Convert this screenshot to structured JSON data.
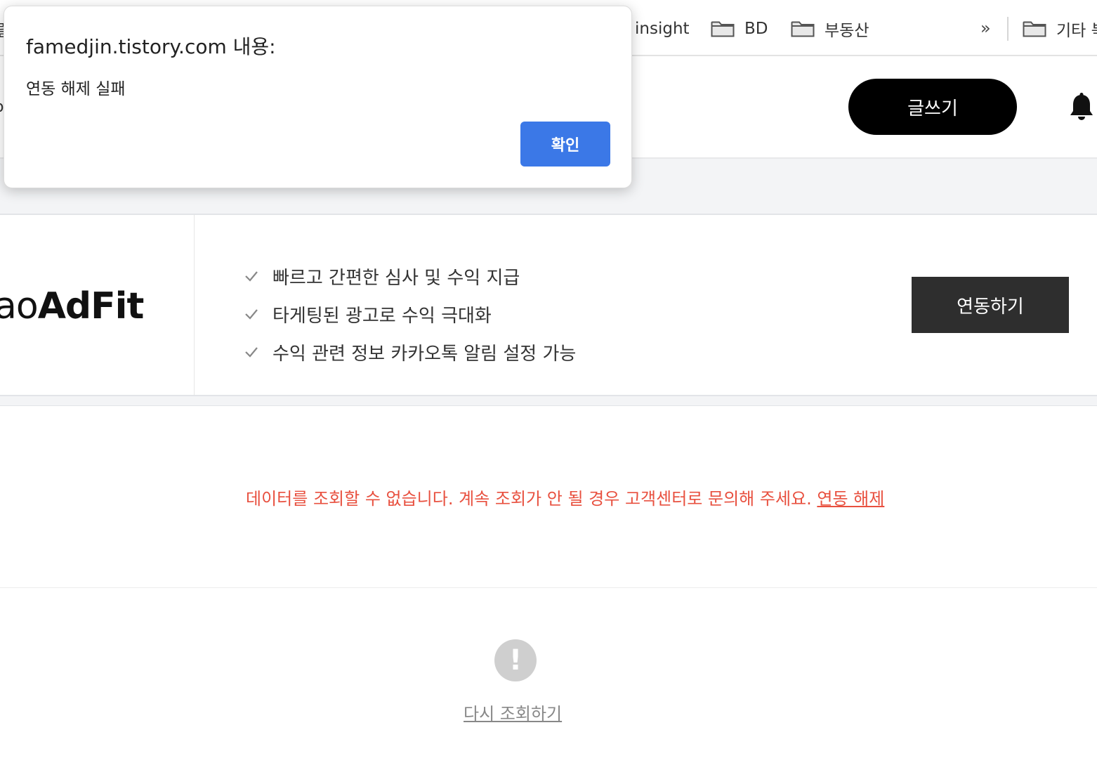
{
  "bookmarks_bar": {
    "left_edge_glyph": "릴",
    "items": [
      {
        "label": "insight",
        "icon": "none"
      },
      {
        "label": "BD",
        "icon": "folder-icon"
      },
      {
        "label": "부동산",
        "icon": "folder-icon"
      }
    ],
    "more_label": "»",
    "other": {
      "label": "기타 북",
      "icon": "folder-icon"
    }
  },
  "header": {
    "left_edge_glyph": "o",
    "write_button": "글쓰기",
    "bell_icon": "bell-icon"
  },
  "adfit": {
    "logo_light": "ao",
    "logo_bold": "AdFit",
    "features": [
      "빠르고 간편한 심사 및 수익 지급",
      "타게팅된 광고로 수익 극대화",
      "수익 관련 정보 카카오톡 알림 설정 가능"
    ],
    "link_button": "연동하기"
  },
  "error": {
    "message": "데이터를 조회할 수 없습니다. 계속 조회가 안 될 경우 고객센터로 문의해 주세요.",
    "unlink_label": "연동 해제",
    "color": "#e8503f"
  },
  "retry": {
    "icon_symbol": "!",
    "label": "다시 조회하기"
  },
  "dialog": {
    "title": "famedjin.tistory.com 내용:",
    "message": "연동 해제 실패",
    "ok_button": "확인",
    "accent": "#3b78e7"
  }
}
